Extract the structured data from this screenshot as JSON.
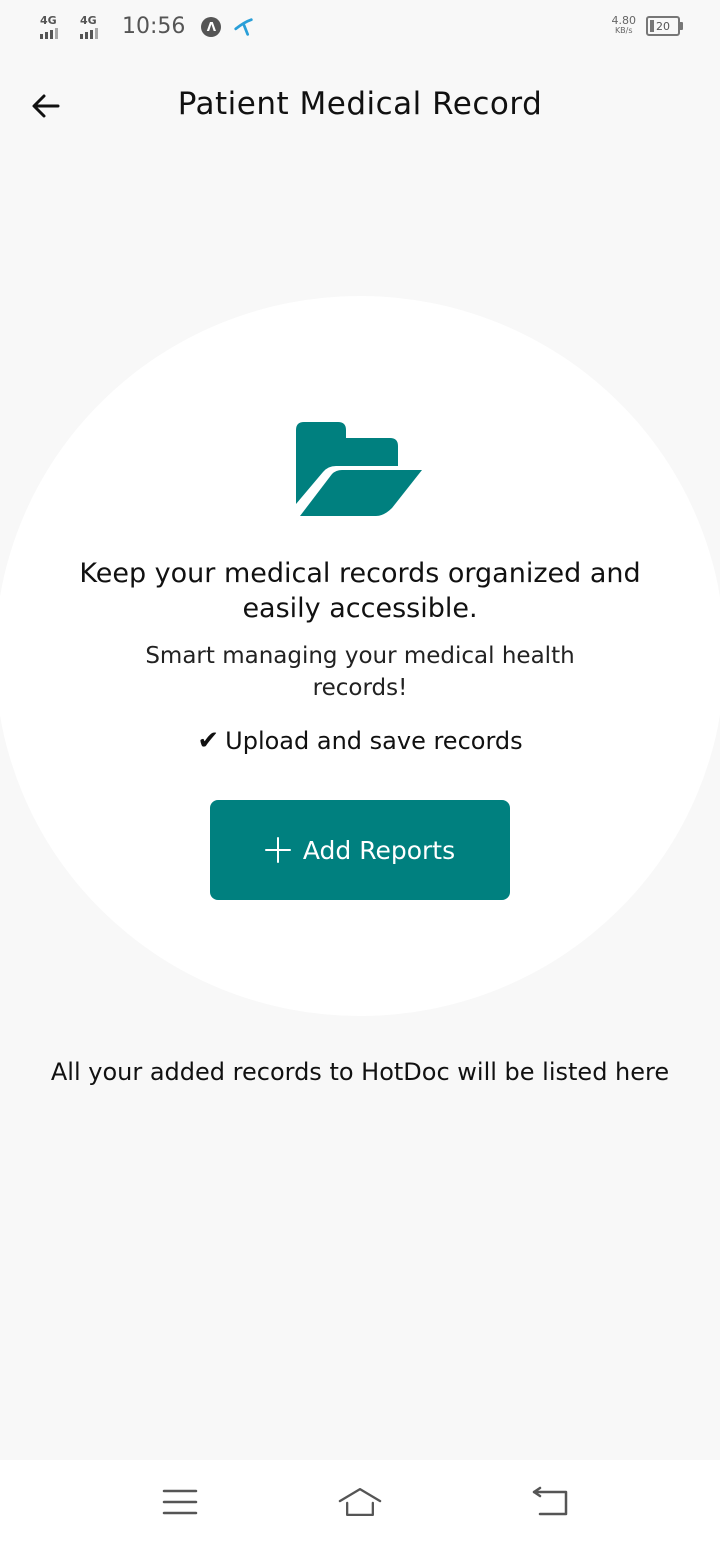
{
  "status_bar": {
    "signal_1": "4G",
    "signal_2": "4G",
    "time": "10:56",
    "net_speed_value": "4.80",
    "net_speed_unit": "KB/s",
    "battery_level": "20"
  },
  "header": {
    "back_icon": "arrow-left-icon",
    "title": "Patient Medical Record"
  },
  "hero": {
    "icon": "folder-open-icon",
    "icon_color": "#00807f",
    "headline": "Keep your medical records organized and easily accessible.",
    "subline": "Smart managing your medical health records!",
    "feature_check": "✔",
    "feature_text": "Upload and save records",
    "add_button_label": "Add Reports",
    "add_button_color": "#00807f"
  },
  "empty_state": {
    "note": "All your added records to HotDoc will be listed here"
  },
  "nav": {
    "menu_icon": "menu-icon",
    "home_icon": "home-icon",
    "back_icon": "back-icon"
  }
}
